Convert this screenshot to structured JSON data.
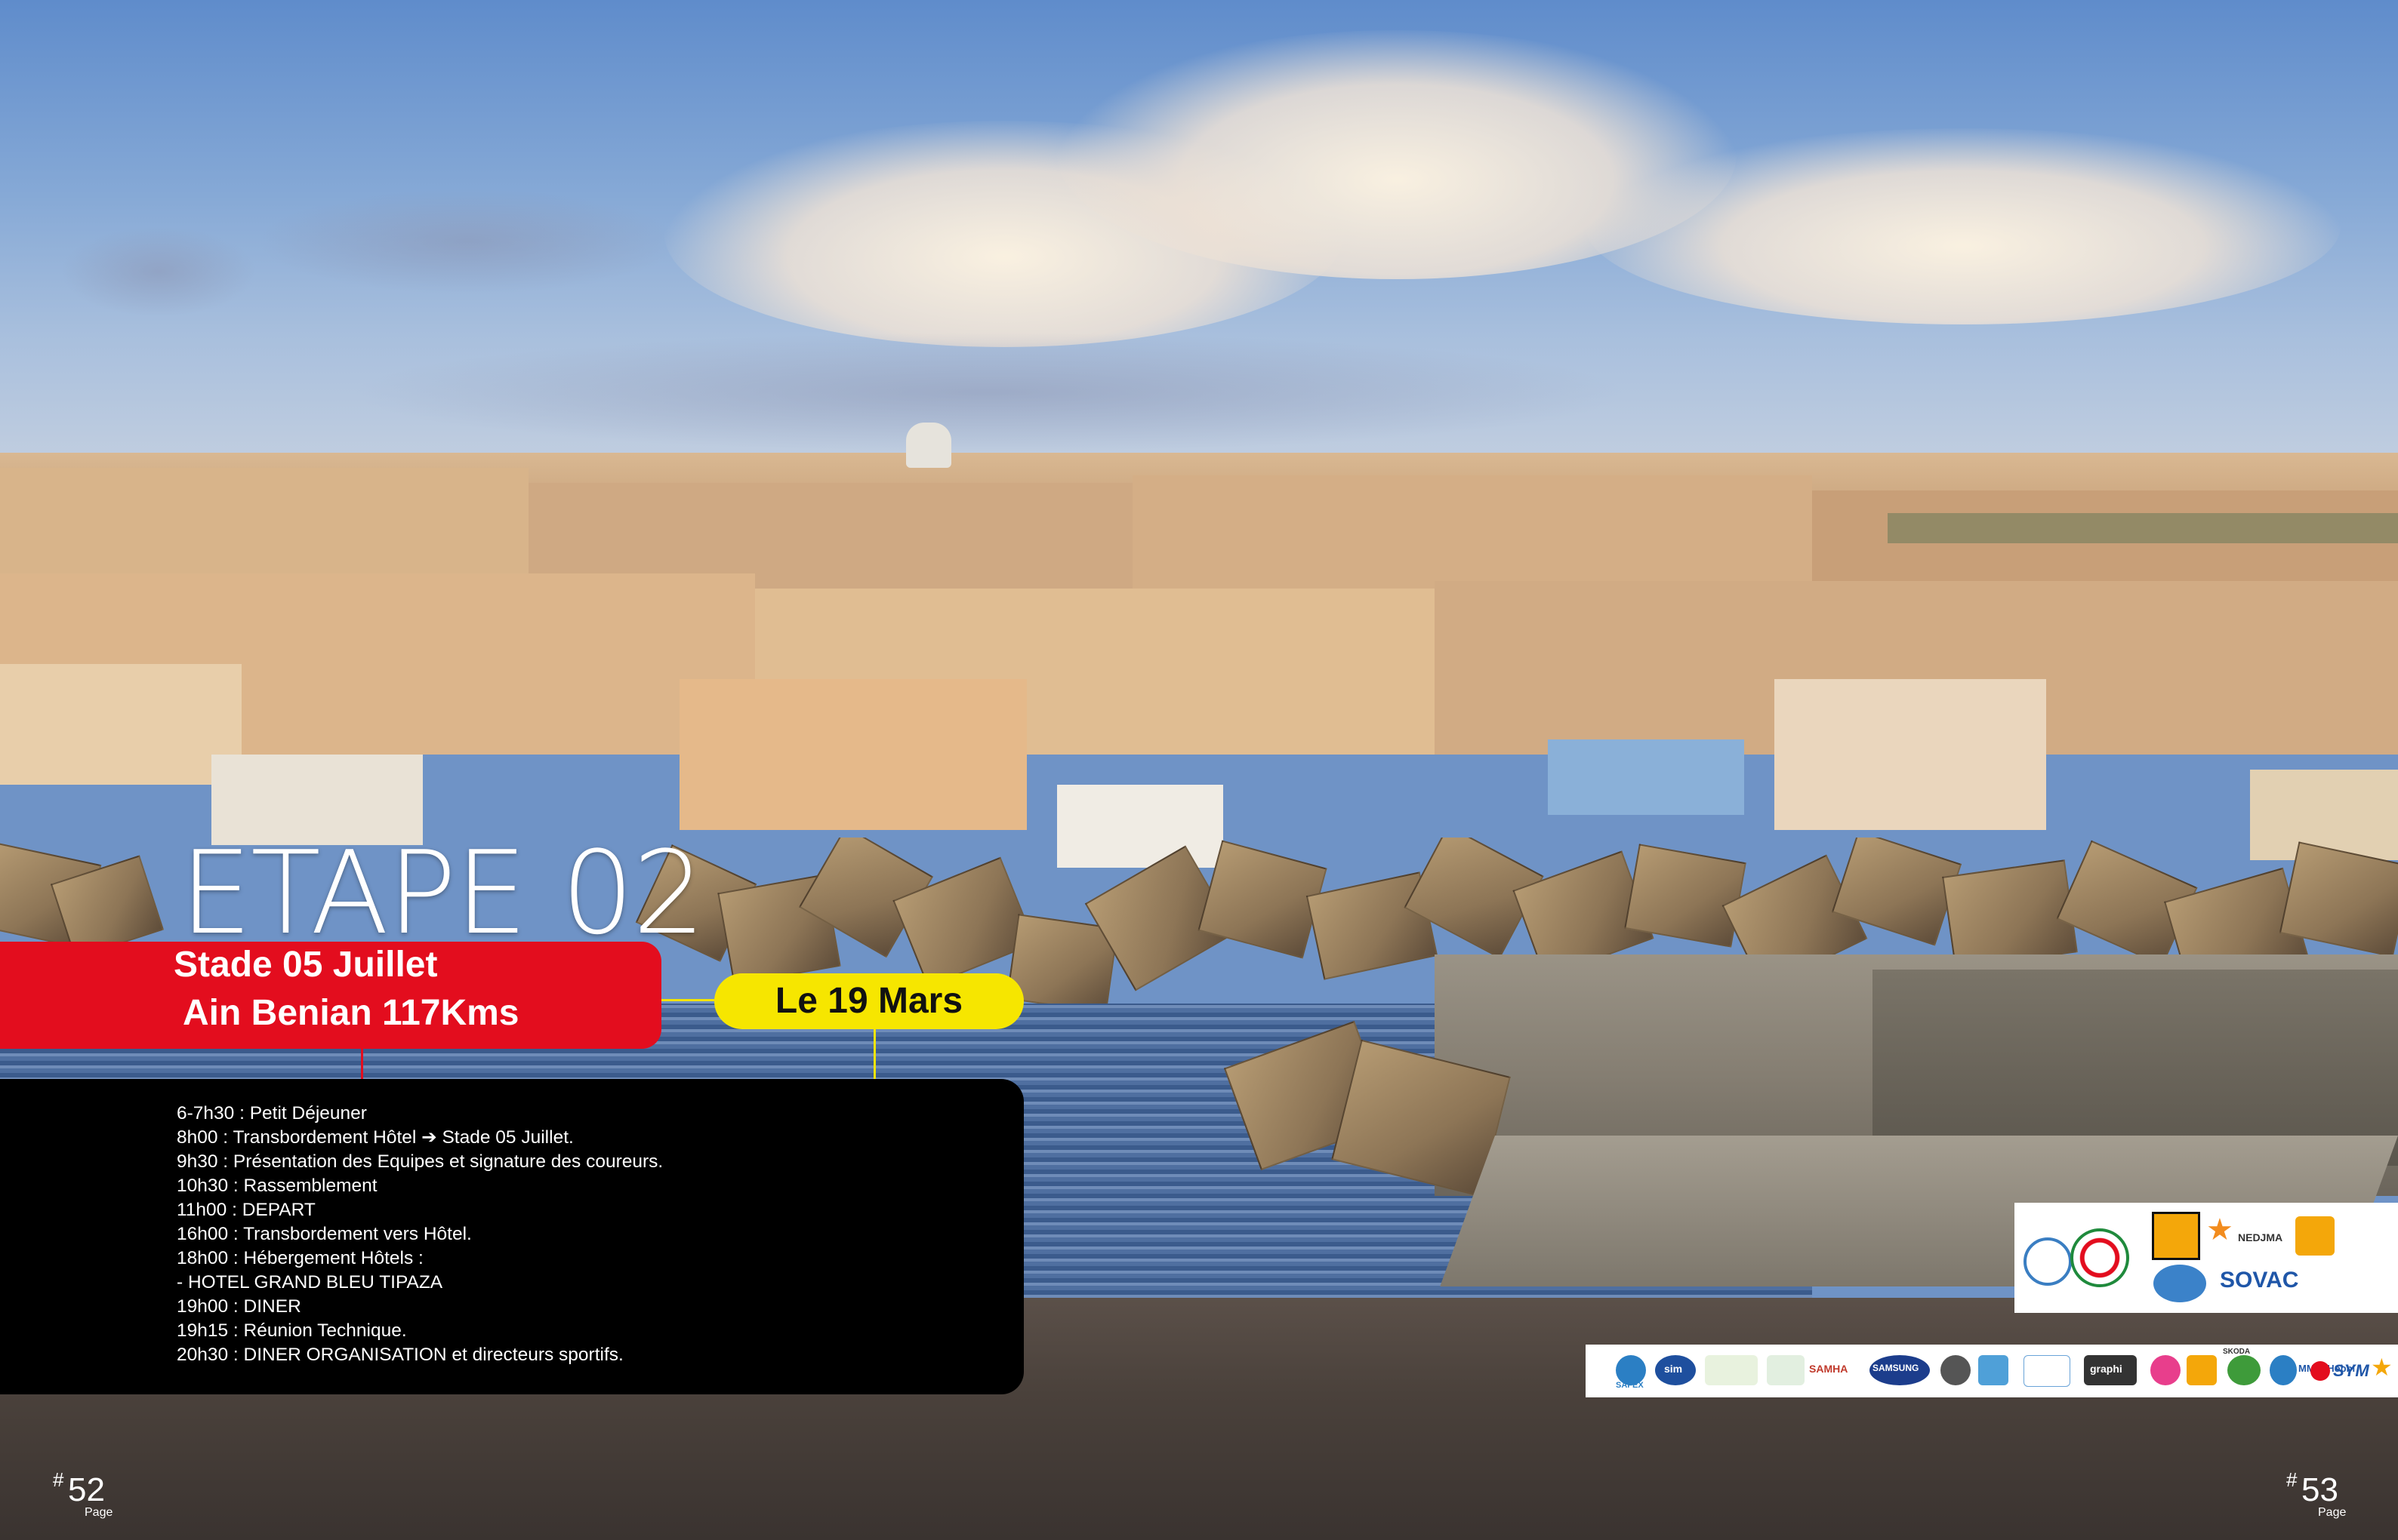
{
  "stage": {
    "title": "ETAPE 02",
    "route_line1": "Stade 05 Juillet",
    "route_line2": "Ain Benian 117Kms",
    "date": "Le 19 Mars"
  },
  "schedule": [
    "6-7h30 : Petit Déjeuner",
    "8h00 : Transbordement Hôtel ➔ Stade 05 Juillet.",
    "9h30 : Présentation des Equipes et signature des coureurs.",
    "10h30 : Rassemblement",
    "11h00 : DEPART",
    "16h00 : Transbordement vers Hôtel.",
    "18h00 : Hébergement Hôtels :",
    "- HOTEL GRAND BLEU TIPAZA",
    "19h00 : DINER",
    "19h15 : Réunion Technique.",
    "20h30 : DINER ORGANISATION et directeurs sportifs."
  ],
  "pages": {
    "left": {
      "hash": "#",
      "number": "52",
      "label": "Page"
    },
    "right": {
      "hash": "#",
      "number": "53",
      "label": "Page"
    }
  },
  "sponsors": {
    "primary_text": "SOVAC",
    "nedjma": "NEDJMA",
    "secondary": [
      "SAFEX",
      "sim",
      "SAMHA",
      "SAMSUNG",
      "graphi",
      "SKODA",
      "MMDI Hobbi",
      "SYM"
    ]
  },
  "colors": {
    "banner_red": "#e30d1e",
    "date_yellow": "#f6e600",
    "schedule_bg": "#000000"
  }
}
